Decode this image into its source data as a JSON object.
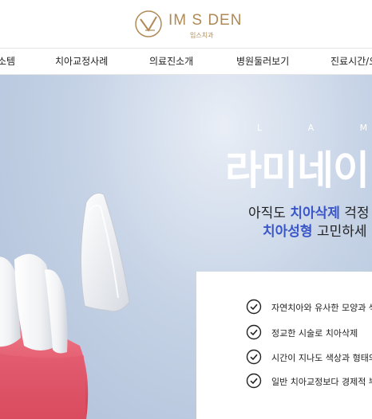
{
  "header": {
    "logo_text": "IM S DEN",
    "logo_sub": "임스치과",
    "brand_color": "#b08a56"
  },
  "nav": {
    "items": [
      {
        "label": "소템"
      },
      {
        "label": "치아교정사례"
      },
      {
        "label": "의료진소개"
      },
      {
        "label": "병원둘러보기"
      },
      {
        "label": "진료시간/오"
      }
    ]
  },
  "hero": {
    "eyebrow": "L A M I N A",
    "title": "라미네이",
    "line1_pre": "아직도 ",
    "line1_hl": "치아삭제",
    "line1_post": " 걱정",
    "line2_hl": "치아성형",
    "line2_post": " 고민하세",
    "accent_color": "#3a56c8"
  },
  "checklist": {
    "icon": "check-circle-icon",
    "items": [
      {
        "text": "자연치아와 유사한 모양과 색상"
      },
      {
        "text": "정교한 시술로 치아삭제"
      },
      {
        "text": "시간이 지나도 색상과 형태의 변"
      },
      {
        "text": "일반 치아교정보다 경제적 부담"
      }
    ]
  }
}
